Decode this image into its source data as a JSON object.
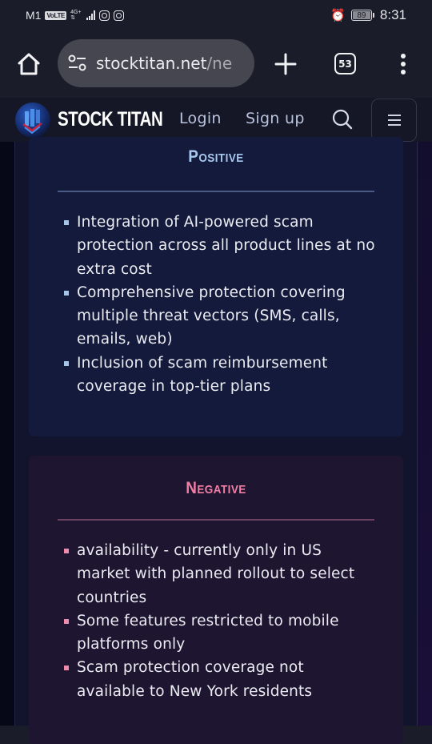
{
  "status_bar": {
    "carrier": "M1",
    "volte_badge": "VoLTE",
    "network_type": "4G+",
    "battery_level": "89",
    "time": "8:31",
    "icons": [
      "volte-icon",
      "signal-icon",
      "instagram-icon",
      "instagram-icon",
      "alarm-icon",
      "battery-icon"
    ]
  },
  "browser": {
    "url_main": "stocktitan.net",
    "url_rest": "/ne",
    "tab_count": "53",
    "icons": [
      "home-icon",
      "site-settings-icon",
      "plus-icon",
      "tabs-icon",
      "more-vert-icon"
    ]
  },
  "site_header": {
    "brand": "STOCK TITAN",
    "login_label": "Login",
    "signup_label": "Sign up",
    "icons": [
      "logo-icon",
      "search-icon",
      "hamburger-icon"
    ]
  },
  "positive": {
    "title": "Positive",
    "accent_color": "#a9c8f0",
    "items": [
      "Integration of AI-powered scam protection across all product lines at no extra cost",
      "Comprehensive protection covering multiple threat vectors (SMS, calls, emails, web)",
      "Inclusion of scam reimbursement coverage in top-tier plans"
    ]
  },
  "negative": {
    "title": "Negative",
    "accent_color": "#f07fa4",
    "items": [
      "availability - currently only in US market with planned rollout to select countries",
      "Some features restricted to mobile platforms only",
      "Scam protection coverage not available to New York residents"
    ]
  }
}
